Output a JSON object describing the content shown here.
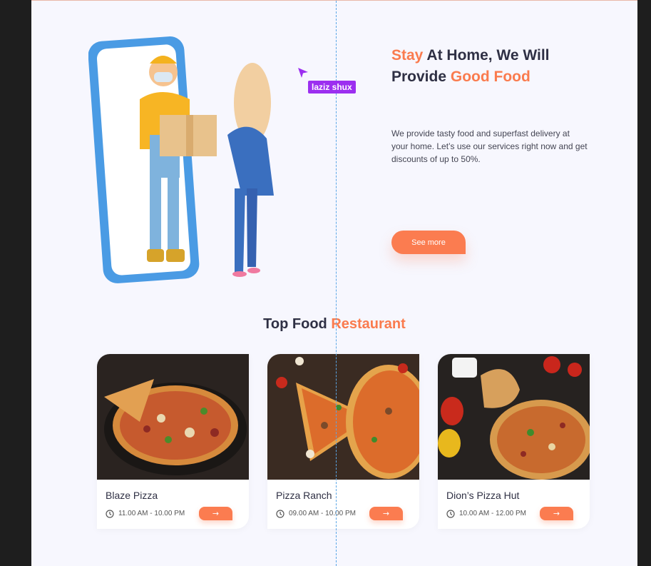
{
  "hero": {
    "title_part1": "Stay",
    "title_part2": " At Home, We Will Provide ",
    "title_part3": "Good Food",
    "description": "We provide tasty food and superfast delivery at your home.  Let’s use our services right now and get discounts of up to 50%.",
    "cta_label": "See more"
  },
  "collaborator": {
    "name": "laziz shux",
    "color": "#9c2ff0"
  },
  "section": {
    "title_part1": "Top Food",
    "title_part2": "Restaurant"
  },
  "restaurants": [
    {
      "name": "Blaze Pizza",
      "hours": "11.00 AM - 10.00 PM",
      "action_icon": "arrow-right-icon"
    },
    {
      "name": "Pizza Ranch",
      "hours": "09.00 AM - 10.00 PM",
      "action_icon": "arrow-right-icon"
    },
    {
      "name": "Dion’s Pizza Hut",
      "hours": "10.00 AM - 12.00 PM",
      "action_icon": "arrow-right-icon"
    }
  ],
  "colors": {
    "accent": "#fb7c50",
    "text": "#2f3044",
    "background": "#f7f7fe"
  }
}
